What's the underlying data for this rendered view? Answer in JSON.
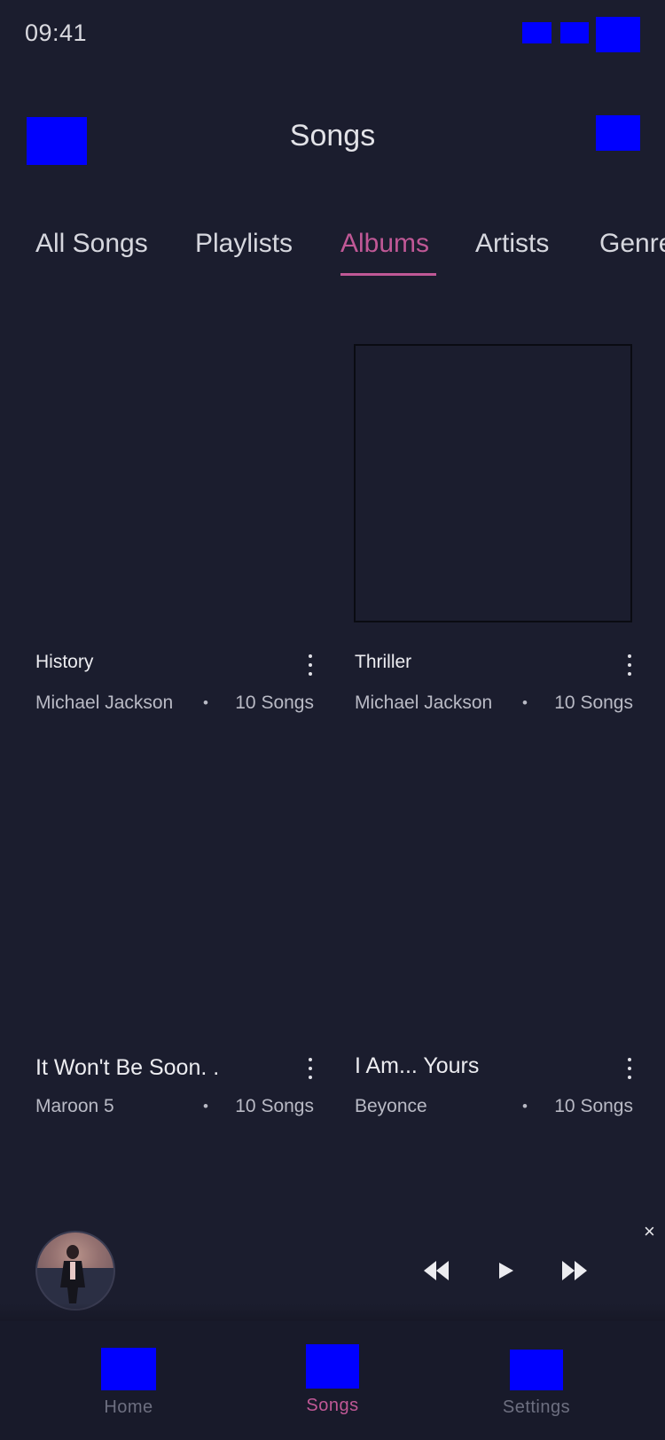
{
  "status_bar": {
    "time": "09:41"
  },
  "header": {
    "title": "Songs"
  },
  "tabs": [
    {
      "label": "All Songs"
    },
    {
      "label": "Playlists"
    },
    {
      "label": "Albums",
      "active": true
    },
    {
      "label": "Artists"
    },
    {
      "label": "Genre"
    }
  ],
  "albums": [
    {
      "title": "History",
      "artist": "Michael Jackson",
      "separator": "•",
      "count": "10 Songs"
    },
    {
      "title": "Thriller",
      "artist": "Michael Jackson",
      "separator": "•",
      "count": "10 Songs"
    },
    {
      "title": "It Won't Be Soon. .",
      "artist": "Maroon 5",
      "separator": "•",
      "count": "10 Songs"
    },
    {
      "title": "I Am... Yours",
      "artist": "Beyonce",
      "separator": "•",
      "count": "10 Songs"
    }
  ],
  "player": {
    "close_glyph": "×"
  },
  "bottom_nav": [
    {
      "label": "Home",
      "icon": "home-icon"
    },
    {
      "label": "Songs",
      "icon": "music-note-icon",
      "active": true
    },
    {
      "label": "Settings",
      "icon": "gear-icon"
    }
  ],
  "colors": {
    "background": "#1b1d2e",
    "accent": "#c05896",
    "nav_background": "#181a2a",
    "placeholder_icon": "#0000ff"
  }
}
